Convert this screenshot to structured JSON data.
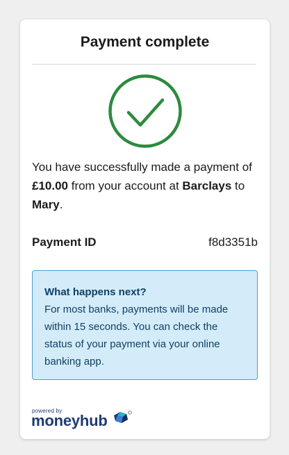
{
  "card": {
    "title": "Payment complete"
  },
  "message": {
    "prefix": "You have successfully made a payment of ",
    "amount": "£10.00",
    "middle": " from your account at ",
    "bank": "Barclays",
    "to": " to ",
    "payee": "Mary",
    "suffix": "."
  },
  "payment": {
    "id_label": "Payment ID",
    "id_value": "f8d3351b"
  },
  "info": {
    "title": "What happens next?",
    "body": "For most banks, payments will be made within 15 seconds. You can check the status of your payment via your online banking app."
  },
  "footer": {
    "powered_by": "powered by",
    "brand": "moneyhub"
  },
  "colors": {
    "success": "#2e8a3e",
    "info_bg": "#d4ecf9",
    "info_border": "#4a9cd6",
    "brand": "#1e3b73",
    "brand_accent": "#2bb3c9"
  },
  "icons": {
    "status": "checkmark-circle-icon",
    "brand_mark": "moneyhub-logo-icon"
  }
}
